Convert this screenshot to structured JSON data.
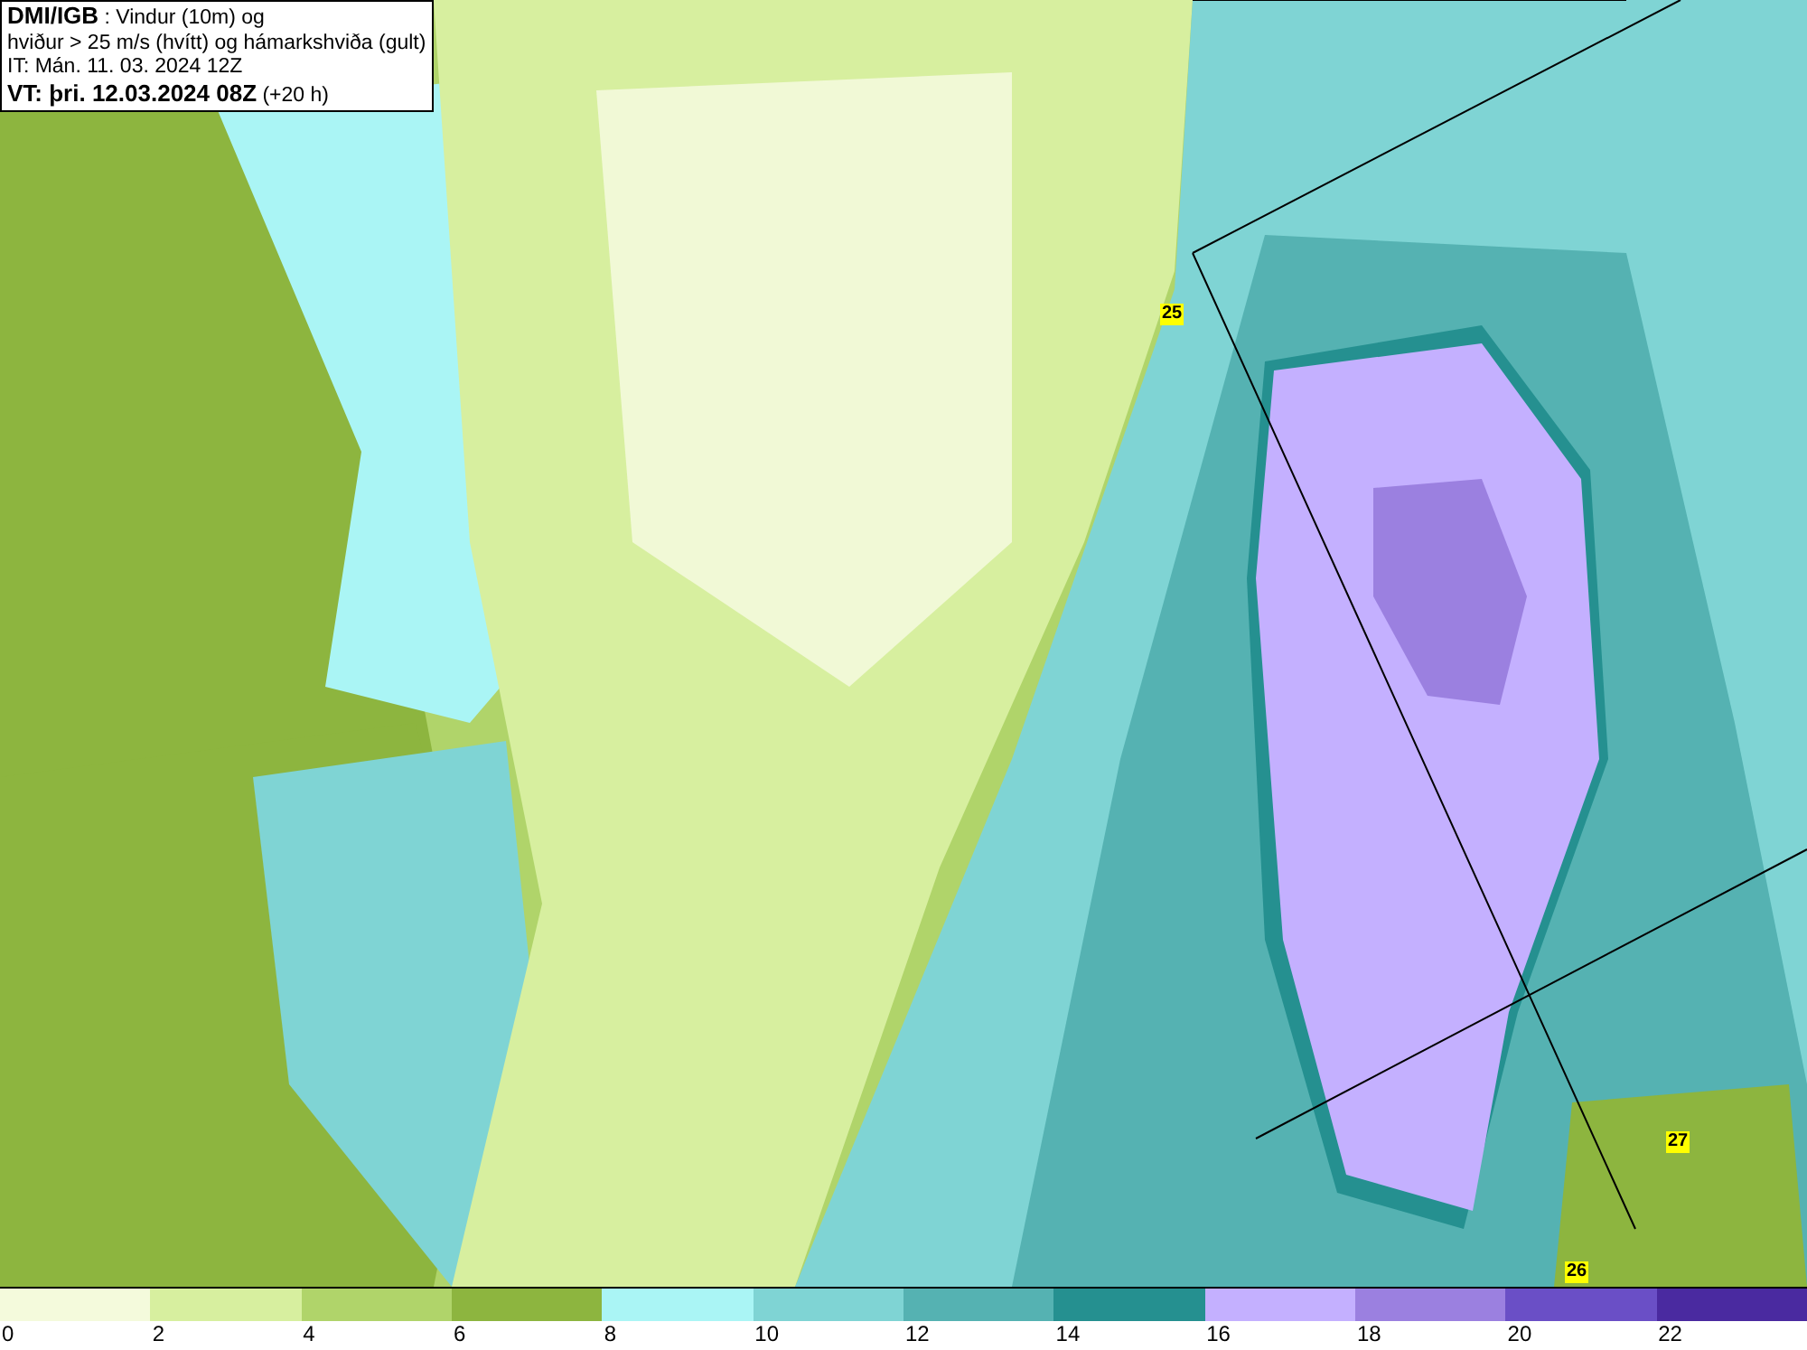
{
  "title_box": {
    "lines": [
      "**DMI/IGB** : Vindur (10m) og",
      "hviður > 25 m/s (hvítt) og hámarkshviða (gult)",
      "IT: Mán. 11. 03. 2024 12Z",
      "**VT: þri. 12.03.2024 08Z** (+20 h)"
    ]
  },
  "map": {
    "gust_labels": [
      "25",
      "27",
      "26"
    ]
  },
  "legend": {
    "bins": [
      {
        "label": "0",
        "color": "#f4fadc"
      },
      {
        "label": "2",
        "color": "#d7ef9f"
      },
      {
        "label": "4",
        "color": "#b0d46a"
      },
      {
        "label": "6",
        "color": "#8db53f"
      },
      {
        "label": "8",
        "color": "#aaf5f5"
      },
      {
        "label": "10",
        "color": "#7fd4d4"
      },
      {
        "label": "12",
        "color": "#55b2b2"
      },
      {
        "label": "14",
        "color": "#259090"
      },
      {
        "label": "16",
        "color": "#c4b0ff"
      },
      {
        "label": "18",
        "color": "#9b80e0"
      },
      {
        "label": "20",
        "color": "#6a4fc6"
      },
      {
        "label": "22",
        "color": "#4a2aa0"
      }
    ]
  }
}
